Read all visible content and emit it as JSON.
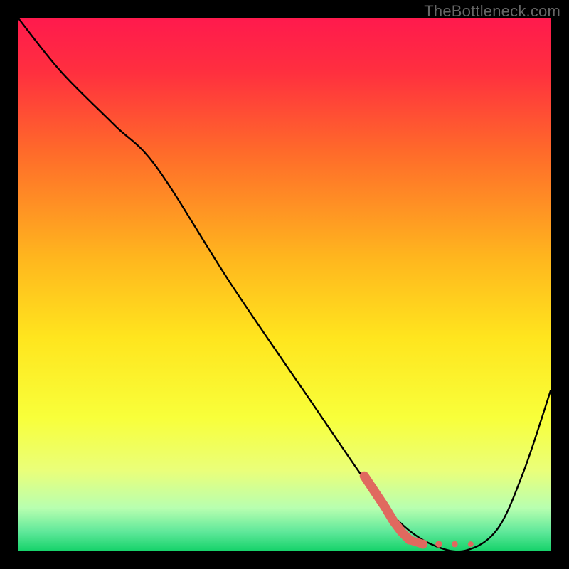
{
  "watermark": "TheBottleneck.com",
  "chart_data": {
    "type": "line",
    "title": "",
    "xlabel": "",
    "ylabel": "",
    "xlim": [
      0,
      100
    ],
    "ylim": [
      0,
      100
    ],
    "series": [
      {
        "name": "curve",
        "x": [
          0,
          8,
          18,
          26,
          40,
          55,
          66,
          72,
          78,
          84,
          90,
          95,
          100
        ],
        "y": [
          100,
          90,
          80,
          72,
          50,
          28,
          12,
          5,
          1,
          0,
          4,
          15,
          30
        ]
      }
    ],
    "overlay": {
      "name": "highlight-dots",
      "points": [
        {
          "x": 65,
          "y": 14
        },
        {
          "x": 67,
          "y": 11
        },
        {
          "x": 69,
          "y": 8
        },
        {
          "x": 70.5,
          "y": 5.5
        },
        {
          "x": 72,
          "y": 3.5
        },
        {
          "x": 73.5,
          "y": 2
        },
        {
          "x": 76,
          "y": 1.2
        },
        {
          "x": 79,
          "y": 1.2
        },
        {
          "x": 82,
          "y": 1.2
        },
        {
          "x": 85,
          "y": 1.2
        }
      ]
    },
    "gradient_stops": [
      {
        "offset": 0.0,
        "color": "#ff1a4d"
      },
      {
        "offset": 0.1,
        "color": "#ff2f3f"
      },
      {
        "offset": 0.25,
        "color": "#ff6a2a"
      },
      {
        "offset": 0.45,
        "color": "#ffb61e"
      },
      {
        "offset": 0.6,
        "color": "#ffe51e"
      },
      {
        "offset": 0.75,
        "color": "#f8ff3a"
      },
      {
        "offset": 0.85,
        "color": "#eaff7a"
      },
      {
        "offset": 0.92,
        "color": "#b8ffb0"
      },
      {
        "offset": 0.965,
        "color": "#5fe89a"
      },
      {
        "offset": 1.0,
        "color": "#17d36b"
      }
    ]
  }
}
